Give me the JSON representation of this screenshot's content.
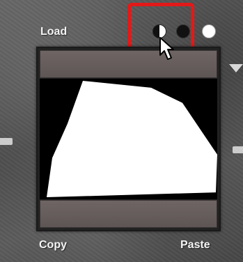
{
  "load_label": "Load",
  "copy_label": "Copy",
  "paste_label": "Paste",
  "mask_modes": [
    {
      "name": "half-black-half-white"
    },
    {
      "name": "black"
    },
    {
      "name": "white"
    }
  ],
  "colors": {
    "highlight": "#e31919",
    "bar": "#6f6565",
    "mask_background": "#000000",
    "mask_shape": "#ffffff"
  },
  "icons": {
    "cursor": "mouse-pointer",
    "expand_arrow": "triangle-down"
  }
}
